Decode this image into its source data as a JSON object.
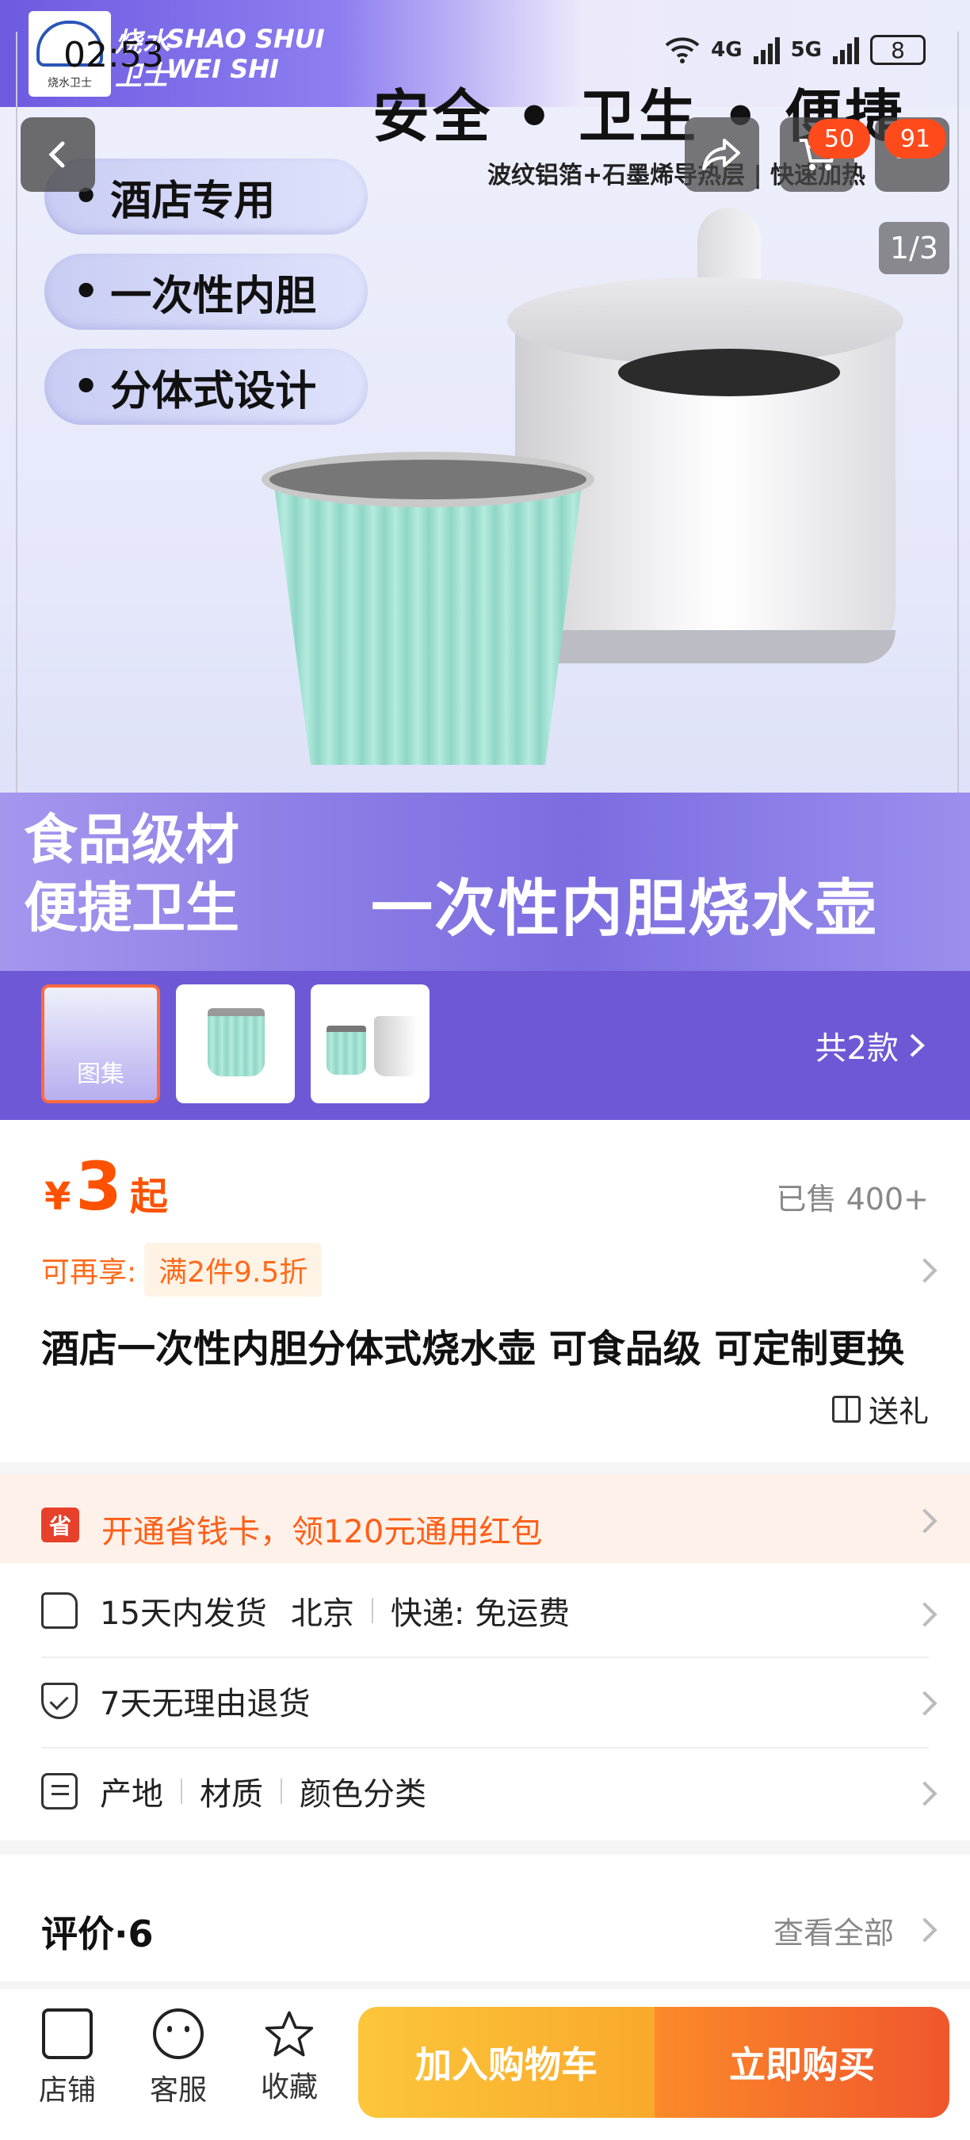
{
  "status_bar": {
    "time": "02:53",
    "network_4g": "4G",
    "network_5g": "5G",
    "battery": "8"
  },
  "hero": {
    "brand_cn": "烧水",
    "brand_cn2": "卫士",
    "brand_en": "SHAO SHUI",
    "brand_en2": "WEI SHI",
    "brand_small": "烧水卫士",
    "headline": "安全 • 卫生 • 便捷",
    "subline": "波纹铝箔+石墨烯导热层 | 快速加热",
    "features": [
      "酒店专用",
      "一次性内胆",
      "分体式设计"
    ],
    "banner_left_line1": "食品级材",
    "banner_left_line2": "便捷卫生",
    "banner_right": "一次性内胆烧水壶",
    "image_counter": "1/3"
  },
  "overlay": {
    "share_badge": "50",
    "cart_badge": "91"
  },
  "thumbnails": {
    "gallery_label": "图集",
    "variants_text": "共2款"
  },
  "product": {
    "currency": "¥",
    "price": "3",
    "price_suffix": "起",
    "sold": "已售 400+",
    "promo_label": "可再享:",
    "promo_tag": "满2件9.5折",
    "title": "酒店一次性内胆分体式烧水壶 可食品级 可定制更换",
    "gift": "送礼"
  },
  "savings": {
    "icon_text": "省",
    "text": "开通省钱卡，领120元通用红包"
  },
  "services": {
    "shipping": [
      "15天内发货",
      "北京",
      "快递: 免运费"
    ],
    "returns": "7天无理由退货",
    "params": [
      "产地",
      "材质",
      "颜色分类"
    ]
  },
  "reviews": {
    "title": "评价·6",
    "view_all": "查看全部"
  },
  "bottom_bar": {
    "store": "店铺",
    "service": "客服",
    "favorite": "收藏",
    "add_to_cart": "加入购物车",
    "buy_now": "立即购买"
  }
}
